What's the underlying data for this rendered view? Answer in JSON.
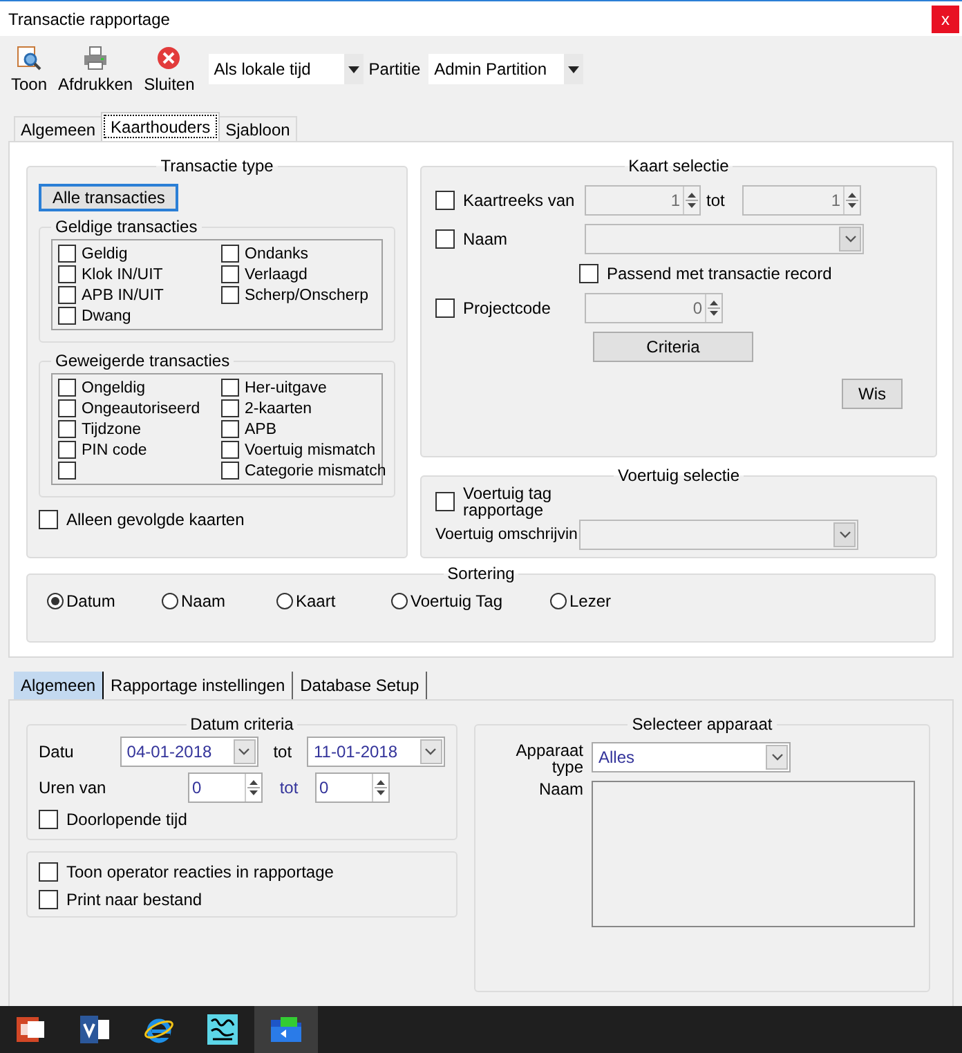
{
  "window": {
    "title": "Transactie rapportage",
    "close": "x"
  },
  "toolbar": {
    "buttons": [
      {
        "label": "Toon",
        "kind": "view"
      },
      {
        "label": "Afdrukken",
        "kind": "print"
      },
      {
        "label": "Sluiten",
        "kind": "close"
      }
    ],
    "time_mode": {
      "value": "Als lokale tijd"
    },
    "partition": {
      "label": "Partitie",
      "value": "Admin Partition"
    }
  },
  "tabs": [
    {
      "label": "Algemeen",
      "selected": false
    },
    {
      "label": "Kaarthouders",
      "selected": true
    },
    {
      "label": "Sjabloon",
      "selected": false
    }
  ],
  "transaction_type": {
    "title": "Transactie type",
    "all_button": "Alle transacties",
    "valid": {
      "title": "Geldige transacties",
      "columns": [
        [
          {
            "label": "Geldig",
            "checked": false
          },
          {
            "label": "Klok IN/UIT",
            "checked": false
          },
          {
            "label": "APB IN/UIT",
            "checked": false
          },
          {
            "label": "Dwang",
            "checked": false
          }
        ],
        [
          {
            "label": "Ondanks",
            "checked": false
          },
          {
            "label": "Verlaagd",
            "checked": false
          },
          {
            "label": "Scherp/Onscherp",
            "checked": false
          }
        ]
      ]
    },
    "refused": {
      "title": "Geweigerde transacties",
      "columns": [
        [
          {
            "label": "Ongeldig",
            "checked": false
          },
          {
            "label": "Ongeautoriseerd",
            "checked": false
          },
          {
            "label": "Tijdzone",
            "checked": false
          },
          {
            "label": "PIN code",
            "checked": false
          },
          {
            "checked": false
          }
        ],
        [
          {
            "label": "Her-uitgave",
            "checked": false
          },
          {
            "label": "2-kaarten",
            "checked": false
          },
          {
            "label": "APB",
            "checked": false
          },
          {
            "label": "Voertuig mismatch",
            "checked": false
          },
          {
            "label": "Categorie mismatch",
            "checked": false
          }
        ]
      ]
    },
    "only_tracked": {
      "label": "Alleen gevolgde kaarten",
      "checked": false
    }
  },
  "card_selection": {
    "title": "Kaart selectie",
    "range": {
      "label": "Kaartreeks van",
      "checked": false,
      "from": "1",
      "to_label": "tot",
      "to": "1",
      "disabled": true
    },
    "name": {
      "label": "Naam",
      "checked": false,
      "disabled": true
    },
    "match": {
      "label": "Passend met transactie record",
      "checked": false
    },
    "project": {
      "label": "Projectcode",
      "checked": false,
      "value": "0",
      "disabled": true
    },
    "criteria_button": "Criteria",
    "clear_button": "Wis"
  },
  "vehicle_selection": {
    "title": "Voertuig selectie",
    "tag": {
      "label": "Voertuig tag rapportage",
      "checked": false
    },
    "description": {
      "label": "Voertuig omschrijvin",
      "disabled": true
    }
  },
  "sorting": {
    "title": "Sortering",
    "options": [
      {
        "label": "Datum",
        "selected": true
      },
      {
        "label": "Naam",
        "selected": false
      },
      {
        "label": "Kaart",
        "selected": false
      },
      {
        "label": "Voertuig Tag",
        "selected": false
      },
      {
        "label": "Lezer",
        "selected": false
      }
    ]
  },
  "bottom_tabs": [
    {
      "label": "Algemeen",
      "selected": true
    },
    {
      "label": "Rapportage instellingen",
      "selected": false
    },
    {
      "label": "Database Setup",
      "selected": false
    }
  ],
  "date_criteria": {
    "title": "Datum criteria",
    "date_label": "Datu",
    "date_from": "04-01-2018",
    "to_label": "tot",
    "date_to": "11-01-2018",
    "hours_label": "Uren van",
    "hours_from": "0",
    "hours_to_label": "tot",
    "hours_to": "0",
    "continuous": {
      "label": "Doorlopende tijd",
      "checked": false
    }
  },
  "options": [
    {
      "label": "Toon operator reacties in rapportage",
      "checked": false
    },
    {
      "label": "Print naar bestand",
      "checked": false
    }
  ],
  "device": {
    "title": "Selecteer apparaat",
    "type_label": "Apparaat type",
    "type_value": "Alles",
    "name_label": "Naam"
  },
  "taskbar": [
    {
      "kind": "slides",
      "active": false
    },
    {
      "kind": "diagram",
      "active": false
    },
    {
      "kind": "browser",
      "active": false
    },
    {
      "kind": "image",
      "active": false
    },
    {
      "kind": "folder",
      "active": true
    }
  ]
}
